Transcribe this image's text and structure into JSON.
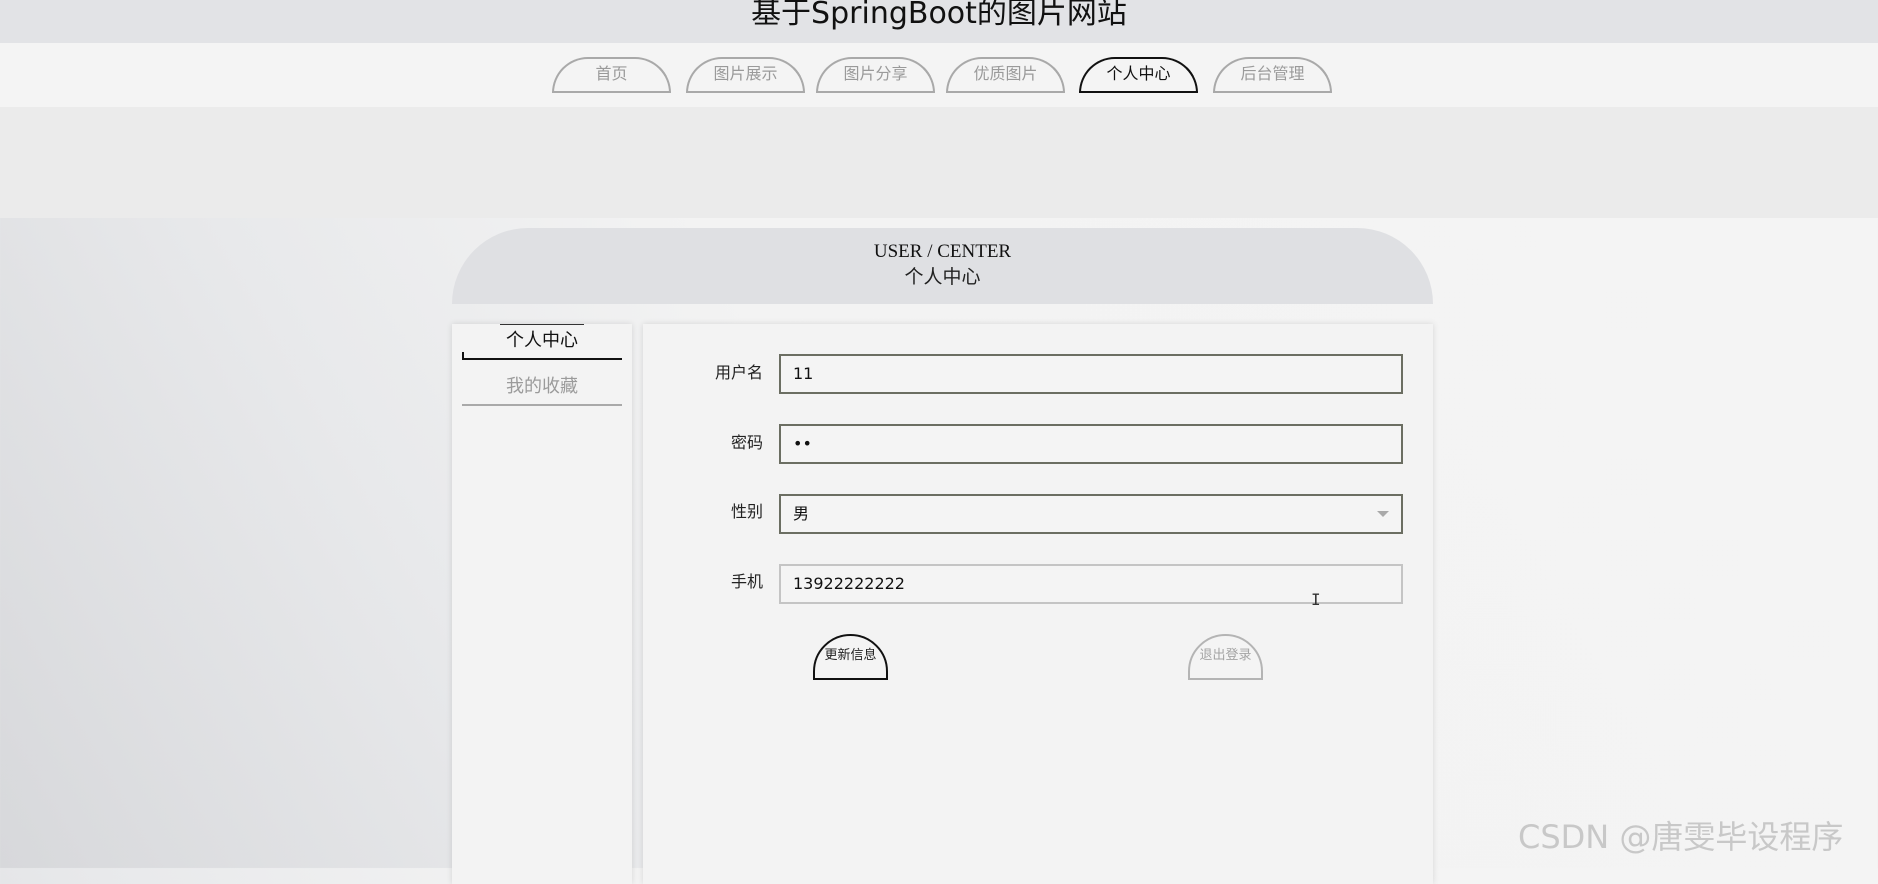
{
  "site": {
    "title": "基于SpringBoot的图片网站"
  },
  "nav": {
    "items": [
      {
        "label": "首页"
      },
      {
        "label": "图片展示"
      },
      {
        "label": "图片分享"
      },
      {
        "label": "优质图片"
      },
      {
        "label": "个人中心",
        "active": true
      },
      {
        "label": "后台管理"
      }
    ]
  },
  "user_center": {
    "title_en": "USER / CENTER",
    "title_cn": "个人中心"
  },
  "sidebar": {
    "items": [
      {
        "label": "个人中心",
        "active": true
      },
      {
        "label": "我的收藏"
      }
    ]
  },
  "form": {
    "username": {
      "label": "用户名",
      "value": "11"
    },
    "password": {
      "label": "密码",
      "value": "••"
    },
    "gender": {
      "label": "性别",
      "value": "男"
    },
    "phone": {
      "label": "手机",
      "value": "13922222222"
    },
    "update_button": "更新信息",
    "logout_button": "退出登录"
  },
  "watermark": "CSDN @唐雯毕设程序"
}
